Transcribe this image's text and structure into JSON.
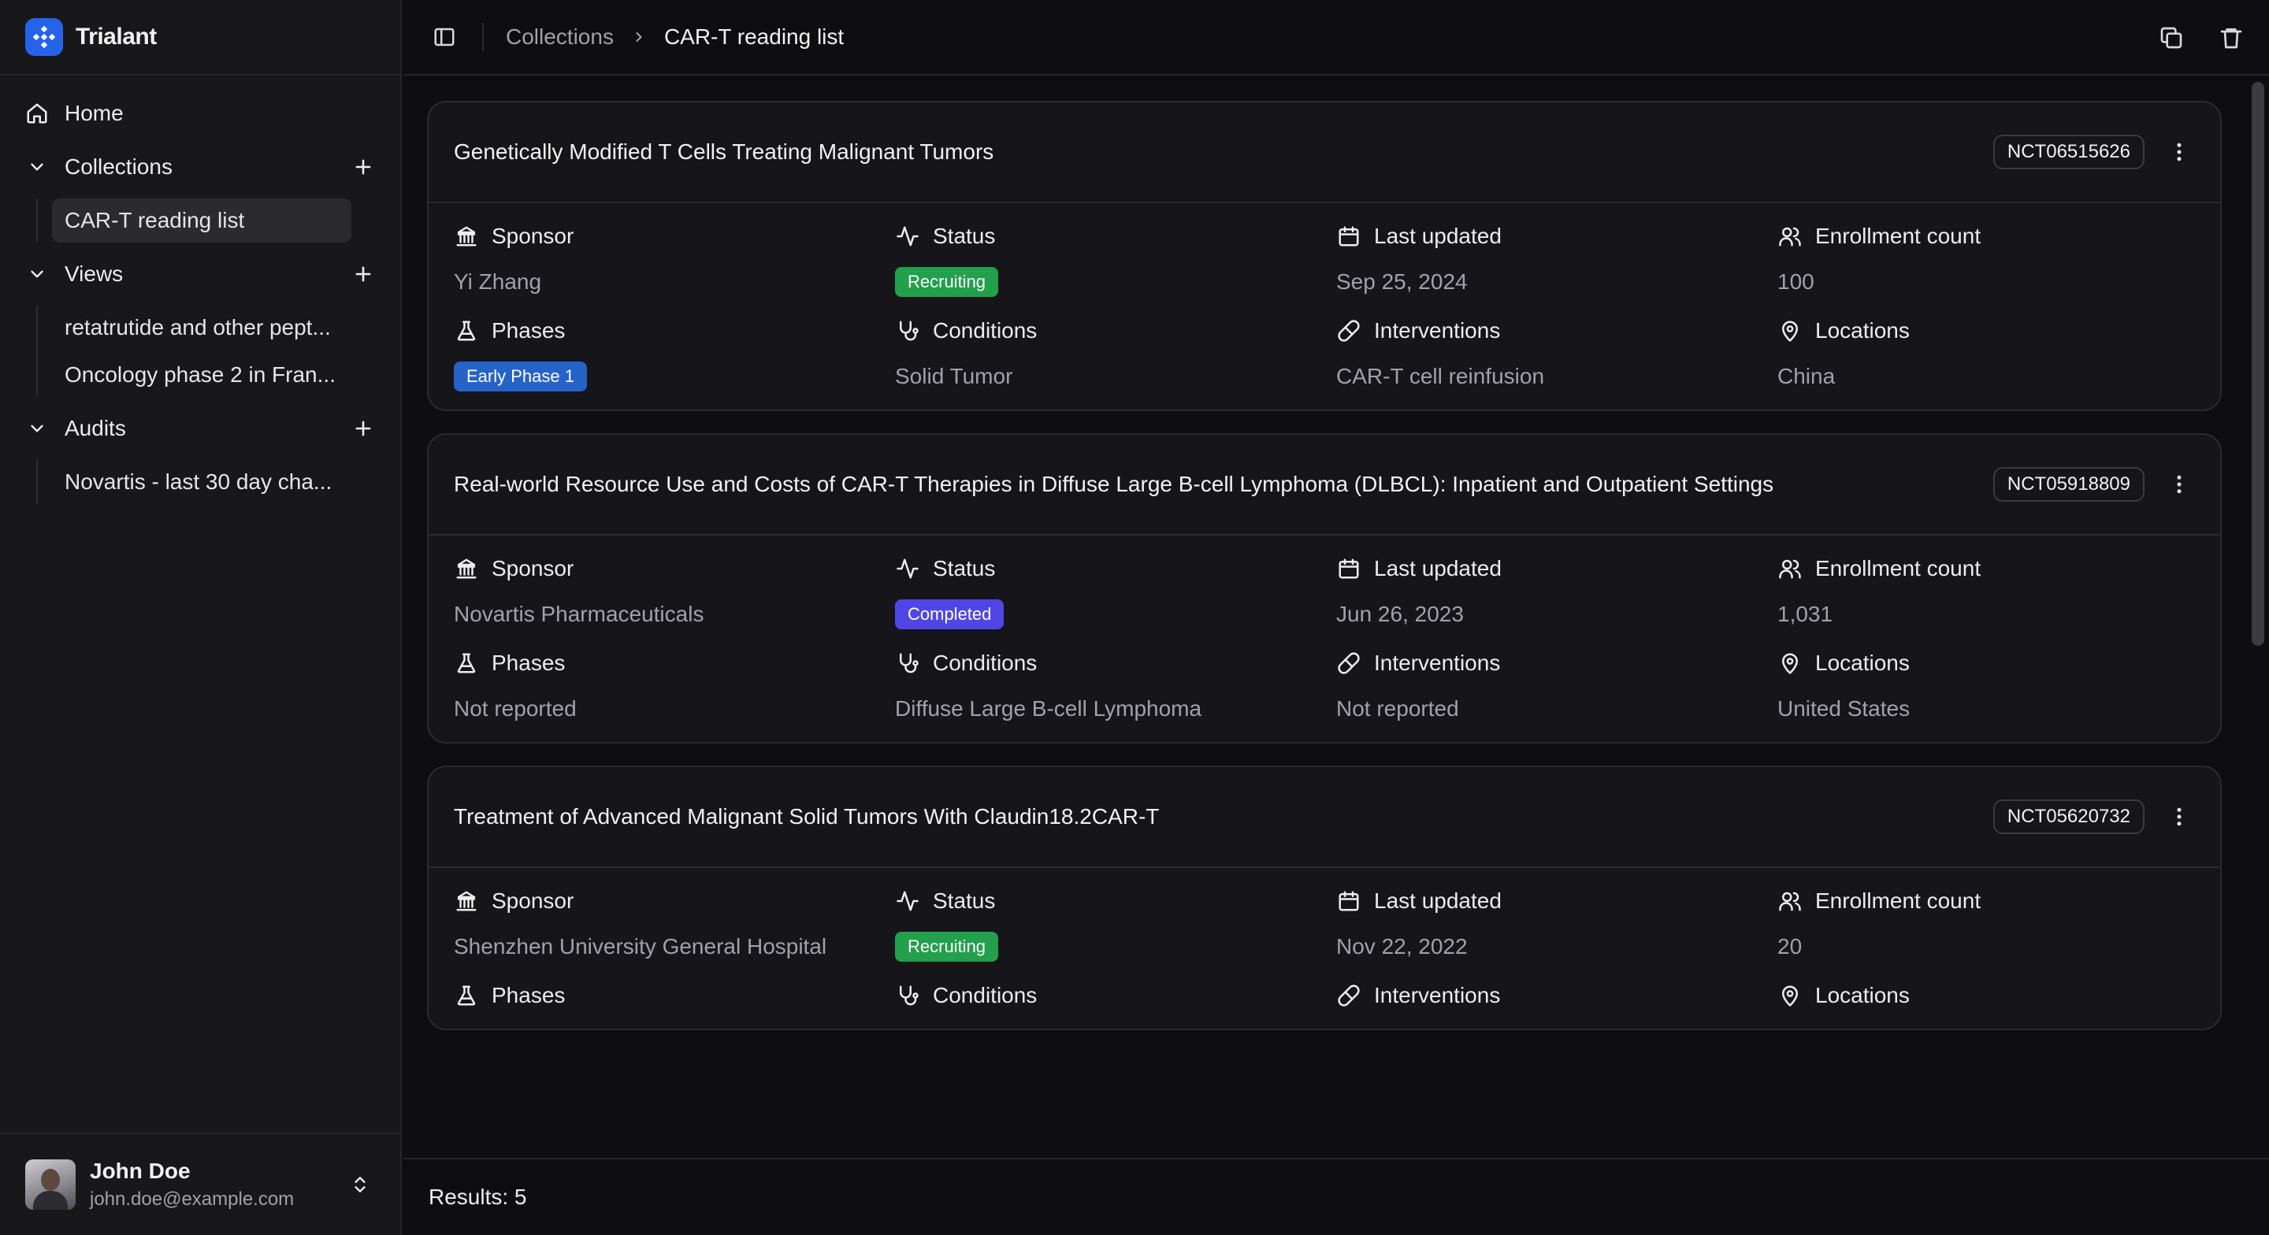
{
  "app": {
    "name": "Trialant"
  },
  "sidebar": {
    "home_label": "Home",
    "sections": [
      {
        "label": "Collections",
        "items": [
          "CAR-T reading list"
        ],
        "active_index": 0
      },
      {
        "label": "Views",
        "items": [
          "retatrutide and other pept...",
          "Oncology phase 2 in Fran..."
        ]
      },
      {
        "label": "Audits",
        "items": [
          "Novartis - last 30 day cha..."
        ]
      }
    ]
  },
  "user": {
    "name": "John Doe",
    "email": "john.doe@example.com"
  },
  "breadcrumb": {
    "parent": "Collections",
    "current": "CAR-T reading list"
  },
  "labels": {
    "sponsor": "Sponsor",
    "status": "Status",
    "last_updated": "Last updated",
    "enrollment": "Enrollment count",
    "phases": "Phases",
    "conditions": "Conditions",
    "interventions": "Interventions",
    "locations": "Locations"
  },
  "trials": [
    {
      "title": "Genetically Modified T Cells Treating Malignant Tumors",
      "nct": "NCT06515626",
      "sponsor": "Yi Zhang",
      "status": "Recruiting",
      "status_color": "#22a04b",
      "last_updated": "Sep 25, 2024",
      "enrollment": "100",
      "phase": "Early Phase 1",
      "phase_is_badge": true,
      "conditions": "Solid Tumor",
      "interventions": "CAR-T cell reinfusion",
      "locations": "China"
    },
    {
      "title": "Real-world Resource Use and Costs of CAR-T Therapies in Diffuse Large B-cell Lymphoma (DLBCL): Inpatient and Outpatient Settings",
      "nct": "NCT05918809",
      "sponsor": "Novartis Pharmaceuticals",
      "status": "Completed",
      "status_color": "#4f46e5",
      "last_updated": "Jun 26, 2023",
      "enrollment": "1,031",
      "phase": "Not reported",
      "phase_is_badge": false,
      "conditions": "Diffuse Large B-cell Lymphoma",
      "interventions": "Not reported",
      "locations": "United States"
    },
    {
      "title": "Treatment of Advanced Malignant Solid Tumors With Claudin18.2CAR-T",
      "nct": "NCT05620732",
      "sponsor": "Shenzhen University General Hospital",
      "status": "Recruiting",
      "status_color": "#22a04b",
      "last_updated": "Nov 22, 2022",
      "enrollment": "20"
    }
  ],
  "footer": {
    "results_label": "Results: 5"
  }
}
